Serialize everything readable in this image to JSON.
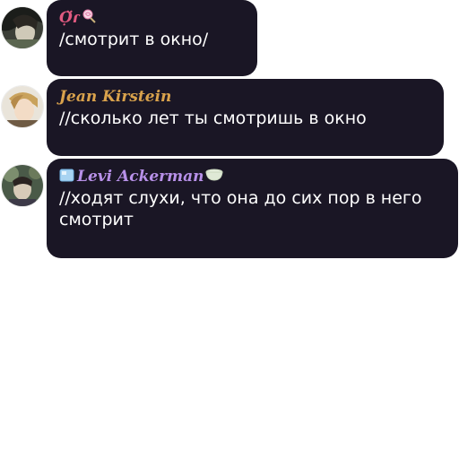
{
  "messages": [
    {
      "author": "Ọ̈ɾ",
      "name_emoji": "lollipop",
      "text": "/смотрит в окно/"
    },
    {
      "author": "Jean Kirstein",
      "text": "//сколько лет ты смотришь в окно"
    },
    {
      "author": "Levi Ackerman",
      "name_emoji_left": "ice-cube",
      "name_emoji_right": "tea-bowl",
      "text": "//ходят слухи, что она до сих пор в него смотрит"
    }
  ],
  "colors": {
    "bubble": "#1a1625",
    "text": "#ffffff",
    "name_1": "#e05a80",
    "name_2": "#d9a24c",
    "name_3": "#b790e8"
  }
}
